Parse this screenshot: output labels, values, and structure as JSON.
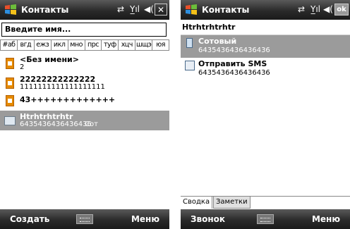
{
  "left": {
    "title": "Контакты",
    "search_placeholder": "Введите имя...",
    "alpha_groups": [
      "#аб",
      "вгд",
      "ежз",
      "икл",
      "мно",
      "прс",
      "туф",
      "хцч",
      "шщэ",
      "юя"
    ],
    "contacts": [
      {
        "name": "<Без имени>",
        "sub": "2"
      },
      {
        "name": "22222222222222",
        "sub": "1111111111111111111"
      },
      {
        "name": "43+++++++++++++",
        "sub": ""
      },
      {
        "name": "Htrhtrhtrhtr",
        "sub": "6435436436436436",
        "type": "Сот"
      }
    ],
    "softkey_left": "Создать",
    "softkey_right": "Меню"
  },
  "right": {
    "title": "Контакты",
    "ok_label": "ok",
    "contact_name": "Htrhtrhtrhtr",
    "details": [
      {
        "label": "Сотовый",
        "value": "6435436436436436"
      },
      {
        "label": "Отправить SMS",
        "value": "6435436436436436"
      }
    ],
    "tabs": [
      "Сводка",
      "Заметки"
    ],
    "softkey_left": "Звонок",
    "softkey_right": "Меню"
  }
}
